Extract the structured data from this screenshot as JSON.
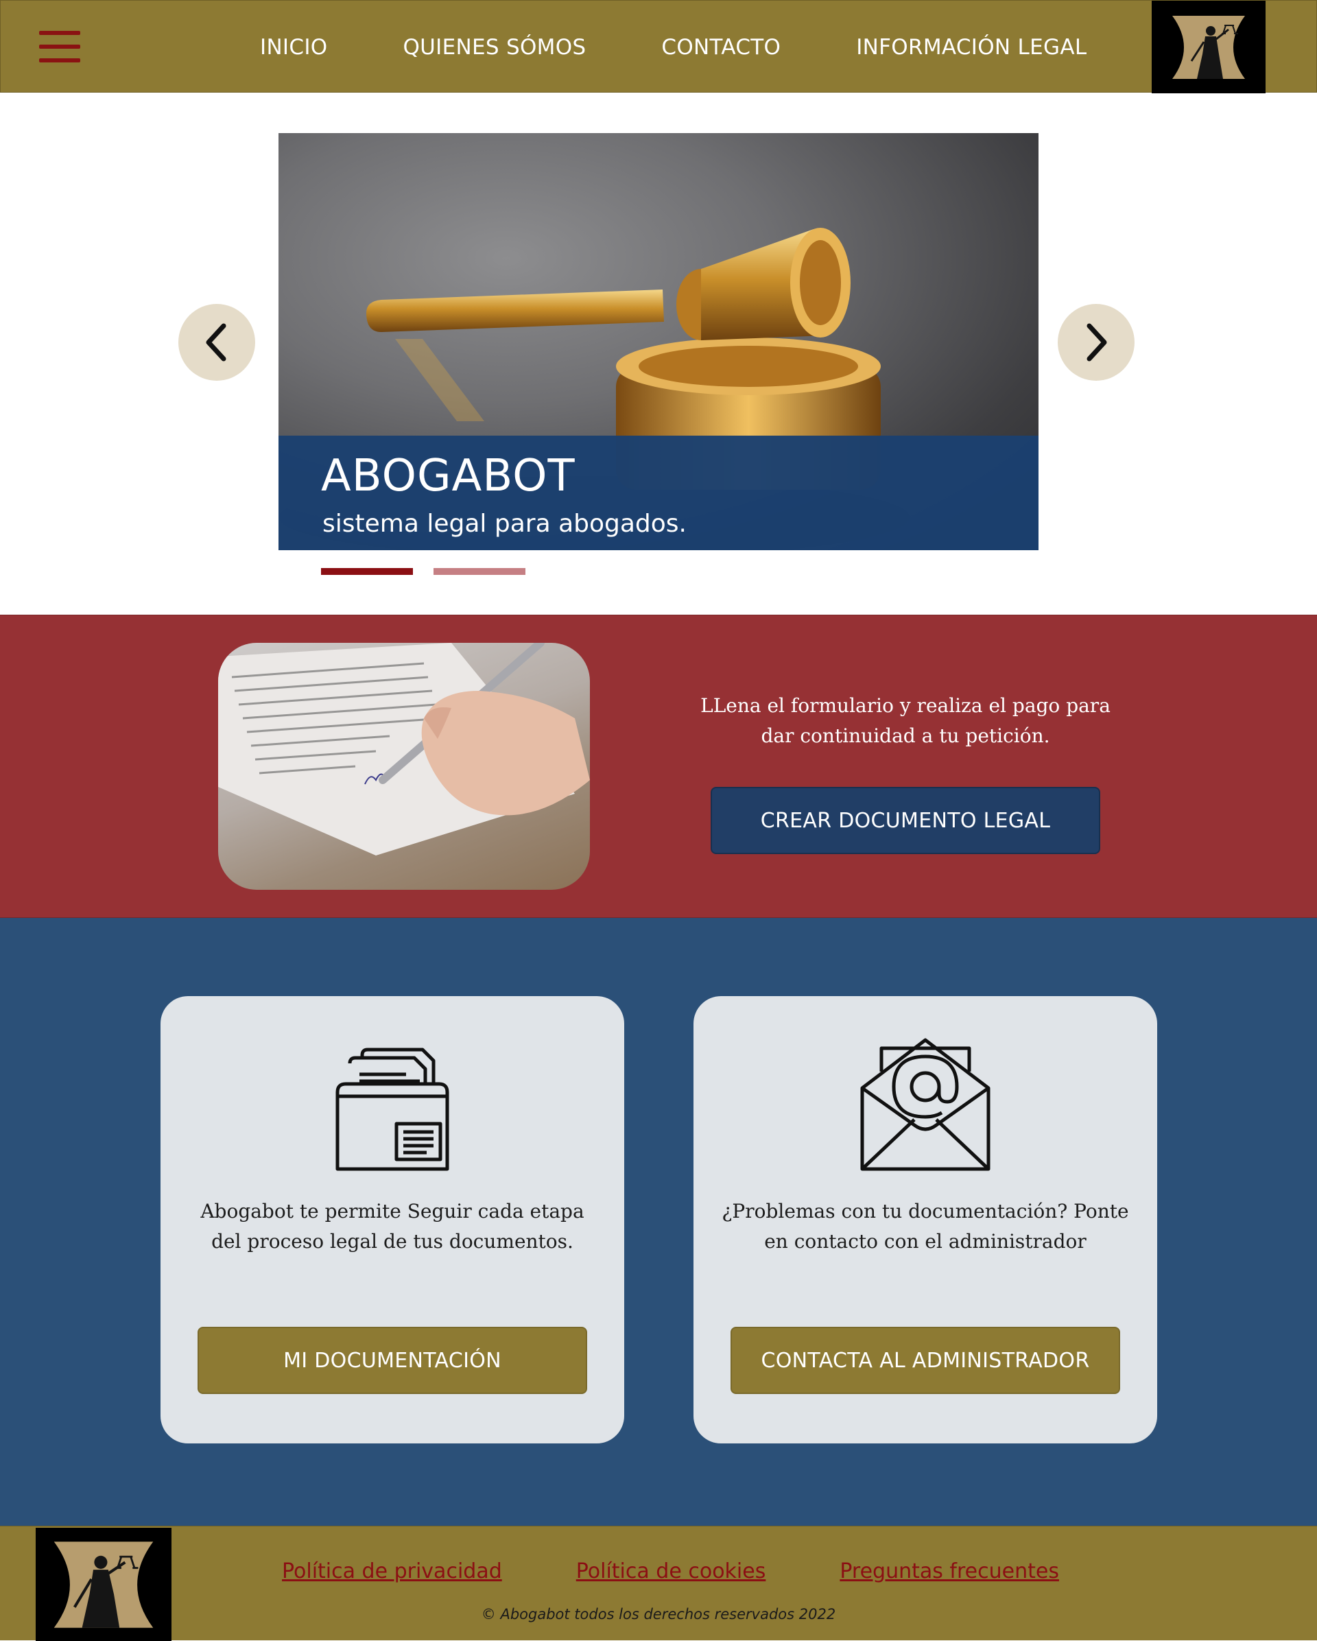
{
  "header": {
    "menu_icon": "hamburger-menu-icon",
    "nav": [
      {
        "label": "INICIO"
      },
      {
        "label": "QUIENES SÓMOS"
      },
      {
        "label": "CONTACTO"
      },
      {
        "label": "INFORMACIÓN LEGAL"
      }
    ],
    "logo_icon": "lady-justice-logo"
  },
  "carousel": {
    "title": "ABOGABOT",
    "subtitle": "sistema legal para abogados.",
    "image_subject": "gavel-image",
    "prev_icon": "chevron-left-icon",
    "next_icon": "chevron-right-icon",
    "indicators": [
      {
        "active": true
      },
      {
        "active": false
      }
    ]
  },
  "form_section": {
    "text": "LLena el formulario y realiza el pago para dar continuidad a tu petición.",
    "button": "CREAR DOCUMENTO LEGAL",
    "image_subject": "signing-document-photo"
  },
  "cards": [
    {
      "icon": "document-folder-icon",
      "text": "Abogabot te permite Seguir cada etapa del proceso legal de tus documentos.",
      "button": "MI DOCUMENTACIÓN"
    },
    {
      "icon": "email-envelope-icon",
      "text": "¿Problemas con tu documentación? Ponte en contacto con el administrador",
      "button": "CONTACTA AL ADMINISTRADOR"
    }
  ],
  "footer": {
    "links": [
      {
        "label": "Política de privacidad"
      },
      {
        "label": "Política de cookies"
      },
      {
        "label": "Preguntas frecuentes"
      }
    ],
    "copyright": "© Abogabot todos los derechos reservados 2022"
  },
  "colors": {
    "gold": "#8d7a33",
    "red": "#963134",
    "blue": "#2b5078",
    "dark_blue": "#213e66",
    "card_bg": "#e0e4e8",
    "link_red": "#8b0f13"
  }
}
